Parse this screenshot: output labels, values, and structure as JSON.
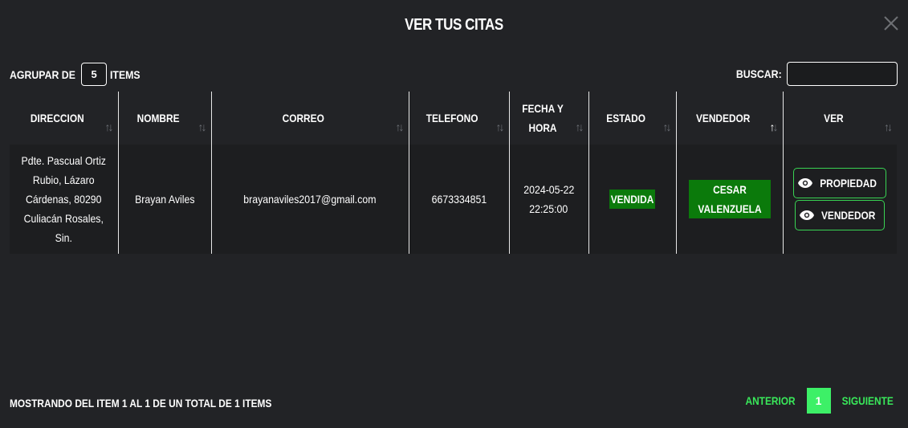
{
  "modal": {
    "title": "VER TUS CITAS"
  },
  "controls": {
    "group_label_before": "AGRUPAR DE",
    "group_value": "5",
    "group_label_after": "ITEMS",
    "search_label": "BUSCAR:",
    "search_value": ""
  },
  "table": {
    "headers": [
      "DIRECCION",
      "NOMBRE",
      "CORREO",
      "TELEFONO",
      "FECHA Y HORA",
      "ESTADO",
      "VENDEDOR",
      "VER"
    ],
    "rows": [
      {
        "direccion": "Pdte. Pascual Ortiz Rubio, Lázaro Cárdenas, 80290 Culiacán Rosales, Sin.",
        "nombre": "Brayan Aviles",
        "correo": "brayanaviles2017@gmail.com",
        "telefono": "6673334851",
        "fecha": "2024-05-22",
        "hora": "22:25:00",
        "estado": "VENDIDA",
        "vendedor": "CESAR VALENZUELA",
        "btn_propiedad": "PROPIEDAD",
        "btn_vendedor": "VENDEDOR"
      }
    ]
  },
  "footer": {
    "info": "MOSTRANDO DEL ITEM 1 AL 1 DE UN TOTAL DE 1 ITEMS",
    "prev": "ANTERIOR",
    "page": "1",
    "next": "SIGUIENTE"
  },
  "colors": {
    "background": "#222326",
    "accent_green": "#39e85a",
    "badge_green": "#0b7a0b"
  },
  "icons": [
    "close-icon",
    "sort-icon",
    "eye-icon"
  ]
}
